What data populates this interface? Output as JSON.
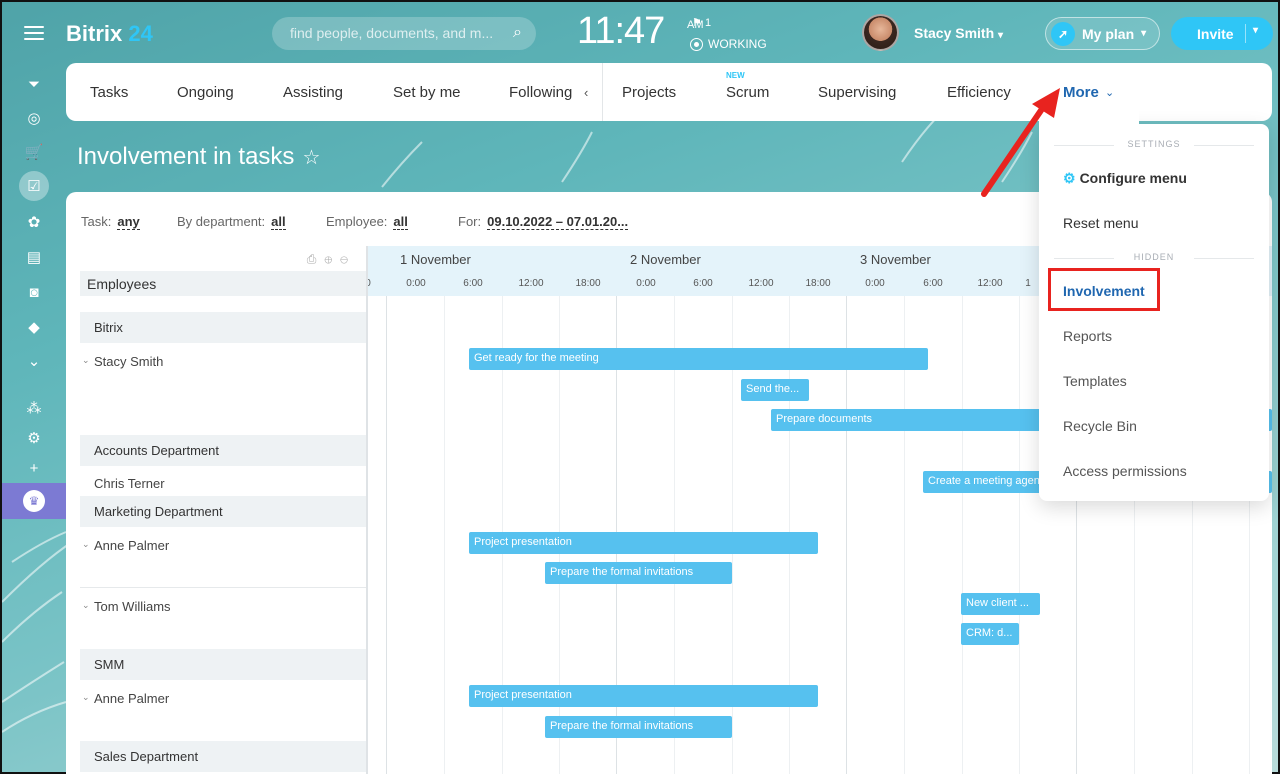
{
  "header": {
    "logo_main": "Bitrix",
    "logo_num": "24",
    "search_placeholder": "find people, documents, and m...",
    "time": "11:47",
    "ampm": "AM",
    "flag_count": "1",
    "status": "WORKING",
    "user_name": "Stacy Smith",
    "my_plan": "My plan",
    "invite": "Invite"
  },
  "tabs": [
    {
      "label": "Tasks"
    },
    {
      "label": "Ongoing"
    },
    {
      "label": "Assisting"
    },
    {
      "label": "Set by me"
    },
    {
      "label": "Following"
    },
    {
      "label": "Projects"
    },
    {
      "label": "Scrum",
      "badge": "NEW"
    },
    {
      "label": "Supervising"
    },
    {
      "label": "Efficiency"
    },
    {
      "label": "More"
    }
  ],
  "page_title": "Involvement in tasks",
  "filters": {
    "task_label": "Task:",
    "task_value": "any",
    "dept_label": "By department:",
    "dept_value": "all",
    "employee_label": "Employee:",
    "employee_value": "all",
    "for_label": "For:",
    "for_value": "09.10.2022 – 07.01.20..."
  },
  "left_column": {
    "header": "Employees",
    "rows": [
      {
        "type": "dept",
        "label": "Bitrix"
      },
      {
        "type": "emp",
        "label": "Stacy Smith",
        "expandable": true
      },
      {
        "type": "dept",
        "label": "Accounts Department"
      },
      {
        "type": "emp",
        "label": "Chris Terner",
        "expandable": false
      },
      {
        "type": "dept",
        "label": "Marketing Department"
      },
      {
        "type": "emp",
        "label": "Anne Palmer",
        "expandable": true
      },
      {
        "type": "emp",
        "label": "Tom Williams",
        "expandable": true
      },
      {
        "type": "dept",
        "label": "SMM"
      },
      {
        "type": "emp",
        "label": "Anne Palmer",
        "expandable": true
      },
      {
        "type": "dept",
        "label": "Sales Department"
      }
    ]
  },
  "gantt": {
    "days": [
      "1 November",
      "2 November",
      "3 November"
    ],
    "hours_partial": "0",
    "hours": [
      "0:00",
      "6:00",
      "12:00",
      "18:00",
      "0:00",
      "6:00",
      "12:00",
      "18:00",
      "0:00",
      "6:00",
      "12:00",
      "1"
    ],
    "tasks": [
      "Get ready for the meeting",
      "Send the...",
      "Prepare documents",
      "Create a meeting agenda",
      "Project presentation",
      "Prepare the formal invitations",
      "New client ...",
      "CRM: d...",
      "Project presentation",
      "Prepare the formal invitations"
    ]
  },
  "more_menu": {
    "settings_section": "SETTINGS",
    "configure": "Configure menu",
    "reset": "Reset menu",
    "hidden_section": "HIDDEN",
    "items": [
      "Involvement",
      "Reports",
      "Templates",
      "Recycle Bin",
      "Access permissions"
    ]
  },
  "colors": {
    "accent": "#2fc6f6",
    "link": "#2067b0",
    "task_bar": "#56c1ef",
    "highlight": "#e8231f"
  }
}
